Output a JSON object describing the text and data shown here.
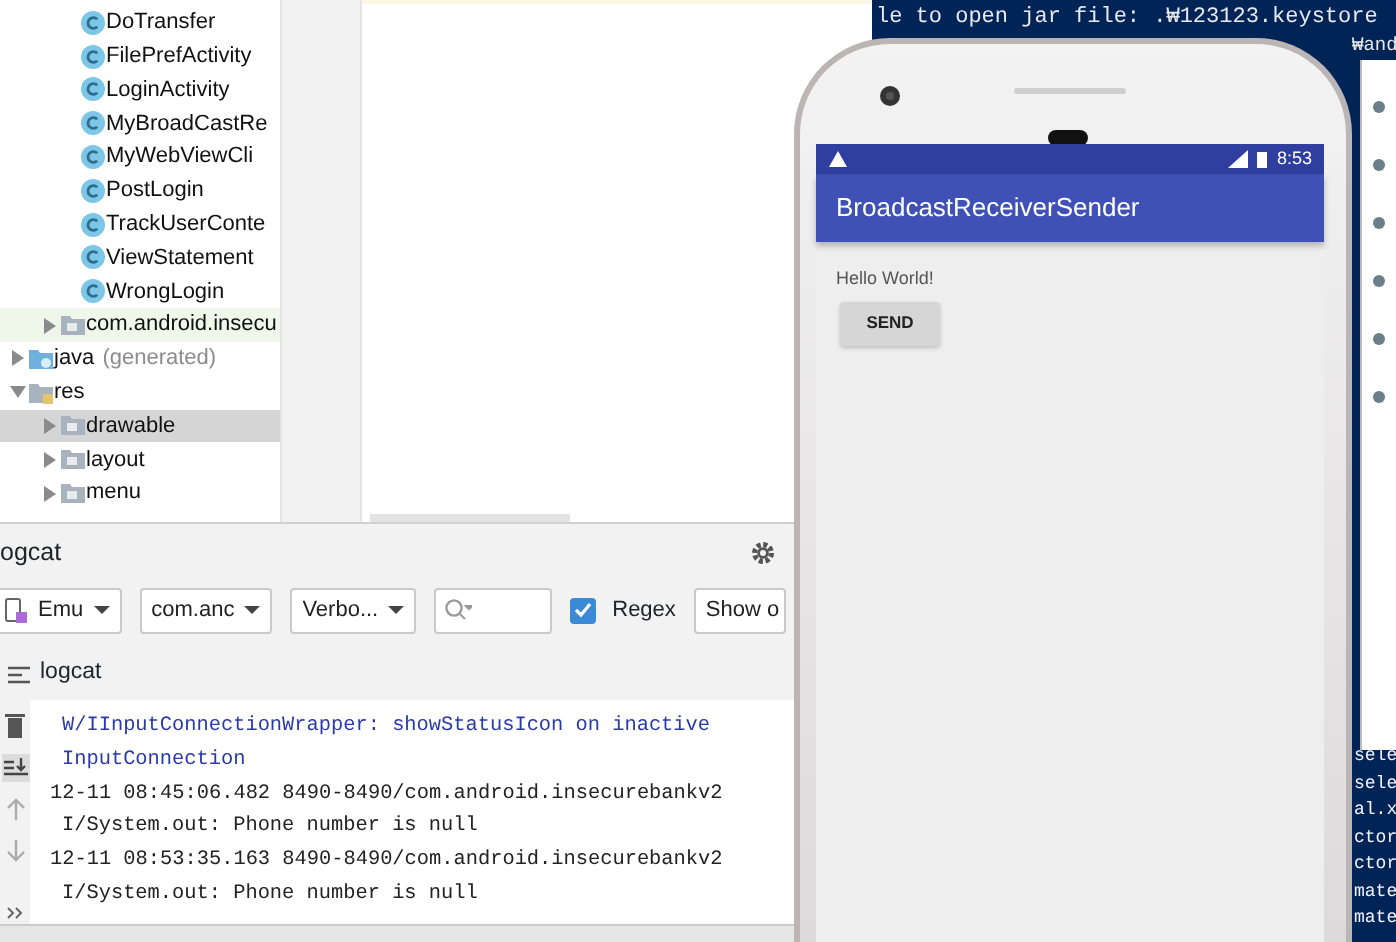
{
  "ide": {
    "tree": [
      {
        "children": [
          {
            "children": [
              {
                "label": "DoTransfer",
                "kind": "class",
                "selected": false,
                "tinted": false
              },
              {
                "label": "FilePrefActivity",
                "kind": "class",
                "selected": false,
                "tinted": false
              },
              {
                "label": "LoginActivity",
                "kind": "class",
                "selected": false,
                "tinted": false
              },
              {
                "label": "MyBroadCastRe",
                "kind": "class",
                "selected": false,
                "tinted": false
              },
              {
                "label": "MyWebViewCli",
                "kind": "class",
                "selected": false,
                "tinted": false
              },
              {
                "label": "PostLogin",
                "kind": "class",
                "selected": false,
                "tinted": false
              },
              {
                "label": "TrackUserConte",
                "kind": "class",
                "selected": false,
                "tinted": false
              },
              {
                "label": "ViewStatement",
                "kind": "class",
                "selected": false,
                "tinted": false
              },
              {
                "label": "WrongLogin",
                "kind": "class",
                "selected": false,
                "tinted": false
              }
            ]
          },
          {
            "label": "com.android.insecu",
            "kind": "folder",
            "expanded": false,
            "selected": false,
            "tinted": true
          }
        ]
      },
      {
        "label": "java",
        "note": "(generated)",
        "kind": "generated",
        "expanded": false,
        "selected": false,
        "tinted": false
      },
      {
        "label": "res",
        "kind": "resources",
        "expanded": true,
        "selected": false,
        "tinted": false,
        "children": [
          {
            "label": "drawable",
            "kind": "folder",
            "expanded": false,
            "selected": true,
            "tinted": false
          },
          {
            "label": "layout",
            "kind": "folder",
            "expanded": false,
            "selected": false,
            "tinted": false
          },
          {
            "label": "menu",
            "kind": "folder",
            "expanded": false,
            "selected": false,
            "tinted": false
          }
        ]
      }
    ],
    "logcat": {
      "title": "ogcat",
      "filters": [
        {
          "kind": "device",
          "label": "Emu"
        },
        {
          "kind": "dropdown",
          "label": "com.anc"
        },
        {
          "kind": "dropdown",
          "label": "Verbo..."
        },
        {
          "kind": "search"
        },
        {
          "kind": "checkbox",
          "label": "Regex",
          "checked": true
        },
        {
          "kind": "button",
          "label": "Show o"
        }
      ],
      "tab": "logcat",
      "lines": [
        {
          "text": "W/IInputConnectionWrapper: showStatusIcon on inactive",
          "kind": "warning",
          "continuation": true
        },
        {
          "text": "InputConnection",
          "kind": "warning",
          "continuation": true
        },
        {
          "text": "12-11 08:45:06.482 8490-8490/com.android.insecurebankv2",
          "kind": "info",
          "continuation": false
        },
        {
          "text": "I/System.out: Phone number is null",
          "kind": "info",
          "continuation": true
        },
        {
          "text": "12-11 08:53:35.163 8490-8490/com.android.insecurebankv2",
          "kind": "info",
          "continuation": false
        },
        {
          "text": "I/System.out: Phone number is null",
          "kind": "info",
          "continuation": true
        }
      ]
    }
  },
  "terminal": {
    "top_line": "le to open jar file: .₩123123.keystore",
    "second_line": "₩and",
    "tail_lines": [
      "sele",
      "sele",
      "al.x",
      "ctor",
      "ctor",
      "mate",
      "mate"
    ]
  },
  "phone": {
    "time": "8:53",
    "app_title": "BroadcastReceiverSender",
    "text": "Hello World!",
    "button": "SEND"
  }
}
